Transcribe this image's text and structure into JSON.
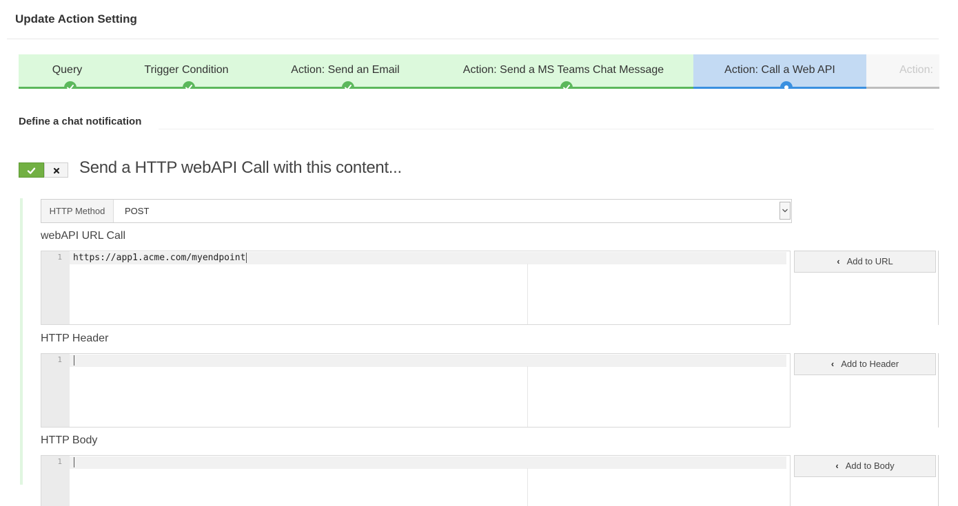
{
  "page": {
    "title": "Update Action Setting"
  },
  "wizard": {
    "steps": [
      {
        "label": "Query",
        "state": "done"
      },
      {
        "label": "Trigger Condition",
        "state": "done"
      },
      {
        "label": "Action: Send an Email",
        "state": "done"
      },
      {
        "label": "Action: Send a MS Teams Chat Message",
        "state": "done"
      },
      {
        "label": "Action: Call a Web API",
        "state": "active"
      },
      {
        "label": "Action:",
        "state": "todo"
      }
    ],
    "colors": {
      "done": "#5cb85c",
      "active": "#3a90e0",
      "done_bg": "#dcf9dc",
      "active_bg": "#c3daf3"
    }
  },
  "section": {
    "title": "Define a chat notification"
  },
  "toggle": {
    "on_icon": "check-icon",
    "off_icon": "close-icon",
    "on_color": "#72b043"
  },
  "webapi": {
    "heading": "Send a HTTP webAPI Call with this content...",
    "method": {
      "addon_label": "HTTP Method",
      "value": "POST"
    },
    "url": {
      "label": "webAPI URL Call",
      "line_number": "1",
      "code": "https://app1.acme.com/myendpoint",
      "button": "Add to URL"
    },
    "header": {
      "label": "HTTP Header",
      "line_number": "1",
      "code": "",
      "button": "Add to Header"
    },
    "body": {
      "label": "HTTP Body",
      "line_number": "1",
      "code": "",
      "button": "Add to Body"
    }
  }
}
